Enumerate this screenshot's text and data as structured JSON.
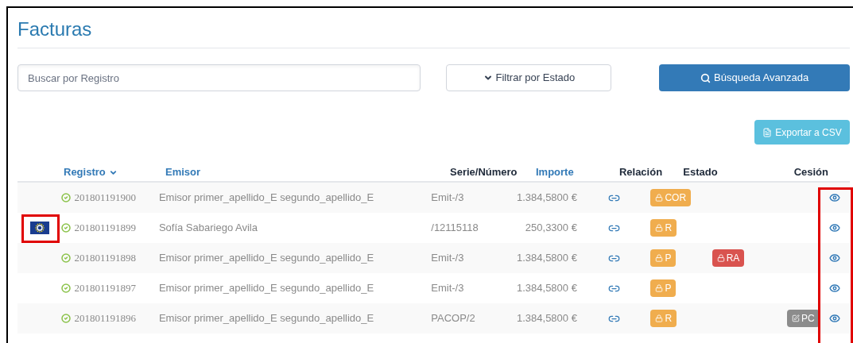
{
  "title": "Facturas",
  "search": {
    "placeholder": "Buscar por Registro"
  },
  "filter_button": {
    "label": "Filtrar por Estado"
  },
  "advanced_search_button": {
    "label": "Búsqueda Avanzada"
  },
  "export_button": {
    "label": "Exportar a CSV"
  },
  "table": {
    "columns": [
      {
        "label": "Registro",
        "sortable": true,
        "link": true
      },
      {
        "label": "Emisor",
        "sortable": false,
        "link": true
      },
      {
        "label": "Serie/Número",
        "sortable": false,
        "link": false
      },
      {
        "label": "Importe",
        "sortable": false,
        "link": true
      },
      {
        "label": "Relación",
        "sortable": false,
        "link": false
      },
      {
        "label": "Estado",
        "sortable": false,
        "link": false
      },
      {
        "label": "Cesión",
        "sortable": false,
        "link": false
      }
    ],
    "flag_highlighted": true,
    "view_column_highlighted": true,
    "rows": [
      {
        "flag": false,
        "registro": "201801191900",
        "emisor": "Emisor primer_apellido_E segundo_apellido_E",
        "serie": "Emit-/3",
        "importe": "1.384,5800 €",
        "estado": {
          "text": "COR",
          "color": "#f0ad4e"
        }
      },
      {
        "flag": true,
        "registro": "201801191899",
        "emisor": "Sofía Sabariego Avila",
        "serie": "/12115118",
        "importe": "250,3300 €",
        "estado": {
          "text": "R",
          "color": "#f0ad4e"
        }
      },
      {
        "flag": false,
        "registro": "201801191898",
        "emisor": "Emisor primer_apellido_E segundo_apellido_E",
        "serie": "Emit-/3",
        "importe": "1.384,5800 €",
        "estado": {
          "text": "P",
          "color": "#f0ad4e"
        },
        "extra": {
          "text": "RA",
          "color": "#d9534f"
        }
      },
      {
        "flag": false,
        "registro": "201801191897",
        "emisor": "Emisor primer_apellido_E segundo_apellido_E",
        "serie": "Emit-/3",
        "importe": "1.384,5800 €",
        "estado": {
          "text": "P",
          "color": "#f0ad4e"
        }
      },
      {
        "flag": false,
        "registro": "201801191896",
        "emisor": "Emisor primer_apellido_E segundo_apellido_E",
        "serie": "PACOP/2",
        "importe": "1.384,5800 €",
        "estado": {
          "text": "R",
          "color": "#f0ad4e"
        },
        "cesion": {
          "text": "PC",
          "color": "#8c8c8c"
        }
      }
    ]
  }
}
